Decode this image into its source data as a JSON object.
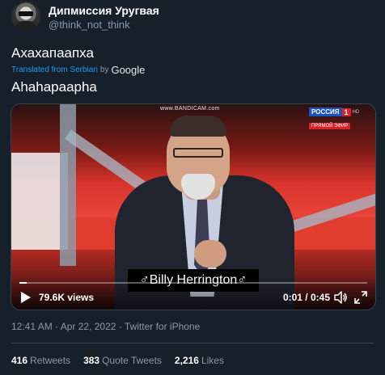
{
  "author": {
    "display_name": "Дипмиссия Уругвая",
    "handle": "@think_not_think"
  },
  "tweet": {
    "text": "Ахахапаапха",
    "translated_prefix": "Translated from Serbian",
    "translated_by": "by",
    "translator": "Google",
    "translation": "Ahahapaapha"
  },
  "video": {
    "watermark": "www.BANDICAM.com",
    "channel_name": "РОССИЯ",
    "channel_number": "1",
    "channel_hd": "HD",
    "live_label": "ПРЯМОЙ ЭФИР",
    "caption": "♂Billy Herrington♂",
    "views": "79.6K views",
    "time": "0:01 / 0:45",
    "progress": 0.02
  },
  "meta": {
    "time": "12:41 AM",
    "separator1": "·",
    "date": "Apr 22, 2022",
    "separator2": "·",
    "source": "Twitter for iPhone"
  },
  "stats": {
    "retweets_count": "416",
    "retweets_label": "Retweets",
    "quotes_count": "383",
    "quotes_label": "Quote Tweets",
    "likes_count": "2,216",
    "likes_label": "Likes"
  },
  "colors": {
    "background": "#15202b",
    "secondary_text": "#8b98a5",
    "link": "#1d9bf0",
    "divider": "#38444d"
  }
}
